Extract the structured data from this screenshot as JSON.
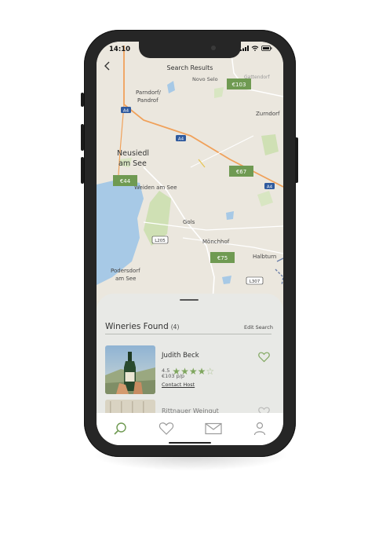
{
  "status_bar": {
    "time": "14:10"
  },
  "header": {
    "title": "Search Results",
    "back_icon": "chevron-left-icon"
  },
  "map": {
    "labels": {
      "novo_selo": "Novo Selo",
      "gattendorf": "Gattendorf",
      "parndorf": "Parndorf/",
      "pandrof": "Pandrof",
      "zurndorf": "Zurndorf",
      "neusiedl1": "Neusiedl",
      "neusiedl2": "am See",
      "weiden": "Weiden am See",
      "gols": "Gols",
      "monchhof": "Mönchhof",
      "halbturn": "Halbturn",
      "podersdorf1": "Podersdorf",
      "podersdorf2": "am See"
    },
    "road_labels": {
      "a4_1": "A4",
      "a4_2": "A4",
      "a4_3": "A4",
      "l205": "L205",
      "l307": "L307"
    },
    "price_markers": [
      "€103",
      "€67",
      "€44",
      "€75"
    ]
  },
  "results": {
    "heading": "Wineries Found",
    "count": "(4)",
    "edit_label": "Edit Search",
    "items": [
      {
        "name": "Judith Beck",
        "rating": "4.5",
        "stars": 4.5,
        "price": "€103 p/p",
        "contact": "Contact Host",
        "favorite_icon": "heart-icon"
      },
      {
        "name": "Rittnauer Weingut"
      }
    ]
  },
  "tabbar": {
    "items": [
      "search-icon",
      "heart-icon",
      "mail-icon",
      "profile-icon"
    ]
  },
  "colors": {
    "accent": "#7fa65e",
    "marker": "#6f9a52",
    "road": "#f0a15a",
    "water": "#a7c9e6"
  }
}
